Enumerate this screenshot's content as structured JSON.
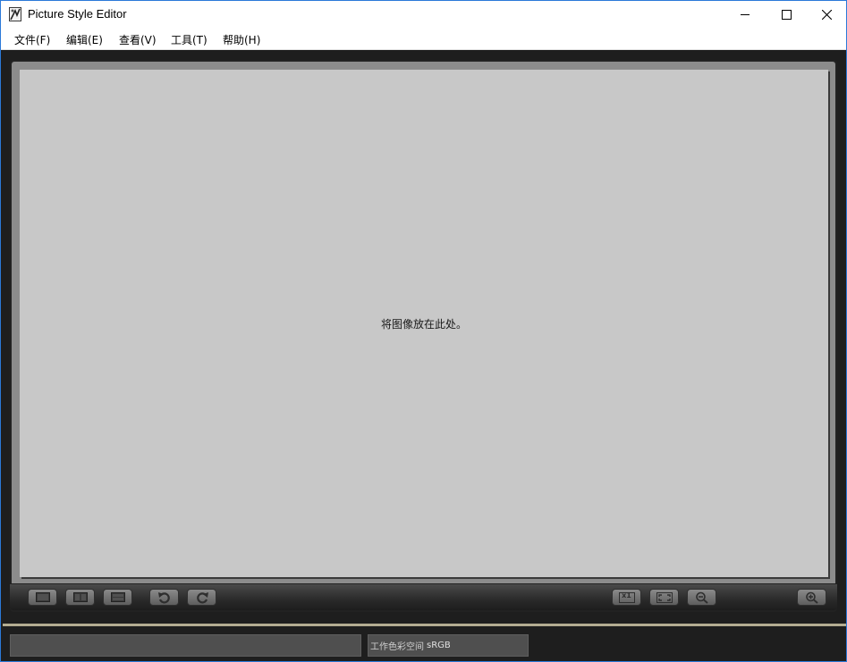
{
  "window": {
    "title": "Picture Style Editor"
  },
  "menu": [
    {
      "label": "文件(F)"
    },
    {
      "label": "编辑(E)"
    },
    {
      "label": "查看(V)"
    },
    {
      "label": "工具(T)"
    },
    {
      "label": "帮助(H)"
    }
  ],
  "canvas": {
    "drop_text": "将图像放在此处。"
  },
  "toolbar": {
    "zoom_1x_label": "x1",
    "icons": [
      "single-view-icon",
      "side-by-side-view-icon",
      "top-bottom-view-icon",
      "rotate-left-icon",
      "rotate-right-icon",
      "zoom-1x-icon",
      "fit-screen-icon",
      "zoom-out-icon",
      "zoom-in-icon"
    ]
  },
  "status": {
    "color_space_label": "工作色彩空间",
    "color_space_value": "sRGB"
  }
}
